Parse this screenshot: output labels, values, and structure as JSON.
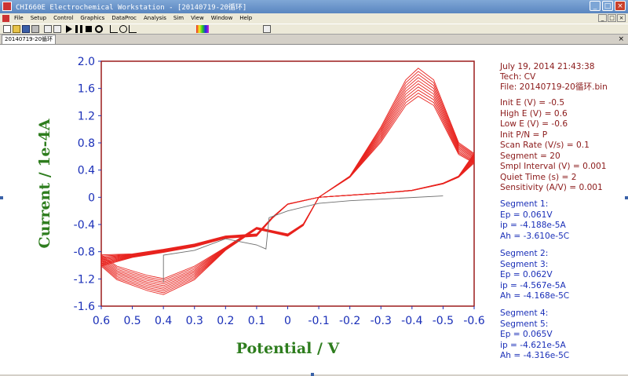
{
  "window": {
    "title": "CHI660E Electrochemical Workstation - [20140719-20循环]",
    "buttons": {
      "minimize": "_",
      "maximize": "□",
      "close": "×"
    }
  },
  "menu": {
    "items": [
      "File",
      "Setup",
      "Control",
      "Graphics",
      "DataProc",
      "Analysis",
      "Sim",
      "View",
      "Window",
      "Help"
    ]
  },
  "document_tab": {
    "label": "20140719-20循环",
    "close": "×"
  },
  "info": {
    "header": [
      "July 19, 2014   21:43:38",
      "Tech: CV",
      "File: 20140719-20循环.bin"
    ],
    "params": [
      "Init E (V) = -0.5",
      "High E (V) = 0.6",
      "Low E (V) = -0.6",
      "Init P/N = P",
      "Scan Rate (V/s) = 0.1",
      "Segment = 20",
      "Smpl Interval (V) = 0.001",
      "Quiet Time (s) = 2",
      "Sensitivity (A/V) = 0.001"
    ],
    "segments": [
      [
        "Segment 1:",
        "Ep = 0.061V",
        "ip = -4.188e-5A",
        "Ah = -3.610e-5C"
      ],
      [
        "Segment 2:",
        "Segment 3:",
        "Ep = 0.062V",
        "ip = -4.567e-5A",
        "Ah = -4.168e-5C"
      ],
      [
        "Segment 4:",
        "Segment 5:",
        "Ep = 0.065V",
        "ip = -4.621e-5A",
        "Ah = -4.316e-5C"
      ]
    ]
  },
  "colors": {
    "curve": "#e8231e",
    "first_scan": "#6e6e6e",
    "axis_label": "#2e7d1e",
    "tick": "#1a2fb8",
    "frame": "#9b1c1c",
    "info_red": "#8b1a1a",
    "info_blue": "#1a2fb8"
  },
  "icons": [
    "new-icon",
    "open-icon",
    "save-icon",
    "print-icon",
    "technique-icon",
    "parameter-icon",
    "run-icon",
    "pause-icon",
    "stop-icon",
    "reverse-icon",
    "graph-icon",
    "zoom-icon",
    "overlay-icon",
    "color-icon",
    "help-icon"
  ],
  "chart_data": {
    "type": "line",
    "xlabel": "Potential / V",
    "ylabel": "Current / 1e-4A",
    "xlim": [
      0.6,
      -0.6
    ],
    "ylim": [
      -1.6,
      2.0
    ],
    "x_ticks": [
      "0.6",
      "0.5",
      "0.4",
      "0.3",
      "0.2",
      "0.1",
      "0",
      "-0.1",
      "-0.2",
      "-0.3",
      "-0.4",
      "-0.5",
      "-0.6"
    ],
    "y_ticks": [
      "2.0",
      "1.6",
      "1.2",
      "0.8",
      "0.4",
      "0",
      "-0.4",
      "-0.8",
      "-1.2",
      "-1.6"
    ],
    "cycles": 10,
    "oxidation_peak": {
      "x": -0.42,
      "y_range": [
        1.3,
        1.9
      ]
    },
    "reduction_peak": {
      "x": 0.43,
      "y_range": [
        -1.05,
        -1.5
      ]
    },
    "first_scan": [
      {
        "x": -0.5,
        "y": 0.02
      },
      {
        "x": -0.2,
        "y": -0.05
      },
      {
        "x": -0.1,
        "y": -0.09
      },
      {
        "x": 0.0,
        "y": -0.2
      },
      {
        "x": 0.06,
        "y": -0.3
      },
      {
        "x": 0.07,
        "y": -0.76
      },
      {
        "x": 0.1,
        "y": -0.7
      },
      {
        "x": 0.2,
        "y": -0.61
      },
      {
        "x": 0.3,
        "y": -0.78
      },
      {
        "x": 0.4,
        "y": -0.85
      },
      {
        "x": 0.4,
        "y": -1.25
      }
    ],
    "sweep_base": [
      {
        "x": -0.6,
        "y": 0.56
      },
      {
        "x": -0.55,
        "y": 0.3
      },
      {
        "x": -0.5,
        "y": 0.2
      },
      {
        "x": -0.4,
        "y": 0.1
      },
      {
        "x": -0.3,
        "y": 0.06
      },
      {
        "x": -0.2,
        "y": 0.03
      },
      {
        "x": -0.1,
        "y": 0.0
      },
      {
        "x": 0.0,
        "y": -0.1
      },
      {
        "x": 0.05,
        "y": -0.3
      },
      {
        "x": 0.1,
        "y": -0.55
      },
      {
        "x": 0.2,
        "y": -0.58
      },
      {
        "x": 0.3,
        "y": -0.7
      },
      {
        "x": 0.4,
        "y": -0.78
      },
      {
        "x": 0.5,
        "y": -0.85
      },
      {
        "x": 0.6,
        "y": -0.92
      },
      {
        "x": 0.55,
        "y": -1.1
      },
      {
        "x": 0.45,
        "y": -1.25
      },
      {
        "x": 0.4,
        "y": -1.3
      },
      {
        "x": 0.3,
        "y": -1.1
      },
      {
        "x": 0.2,
        "y": -0.75
      },
      {
        "x": 0.1,
        "y": -0.45
      },
      {
        "x": 0.05,
        "y": -0.5
      },
      {
        "x": 0.0,
        "y": -0.55
      },
      {
        "x": -0.05,
        "y": -0.4
      },
      {
        "x": -0.1,
        "y": 0.0
      },
      {
        "x": -0.2,
        "y": 0.3
      },
      {
        "x": -0.3,
        "y": 0.9
      },
      {
        "x": -0.38,
        "y": 1.5
      },
      {
        "x": -0.42,
        "y": 1.65
      },
      {
        "x": -0.47,
        "y": 1.5
      },
      {
        "x": -0.52,
        "y": 1.0
      },
      {
        "x": -0.55,
        "y": 0.7
      },
      {
        "x": -0.6,
        "y": 0.56
      }
    ]
  }
}
